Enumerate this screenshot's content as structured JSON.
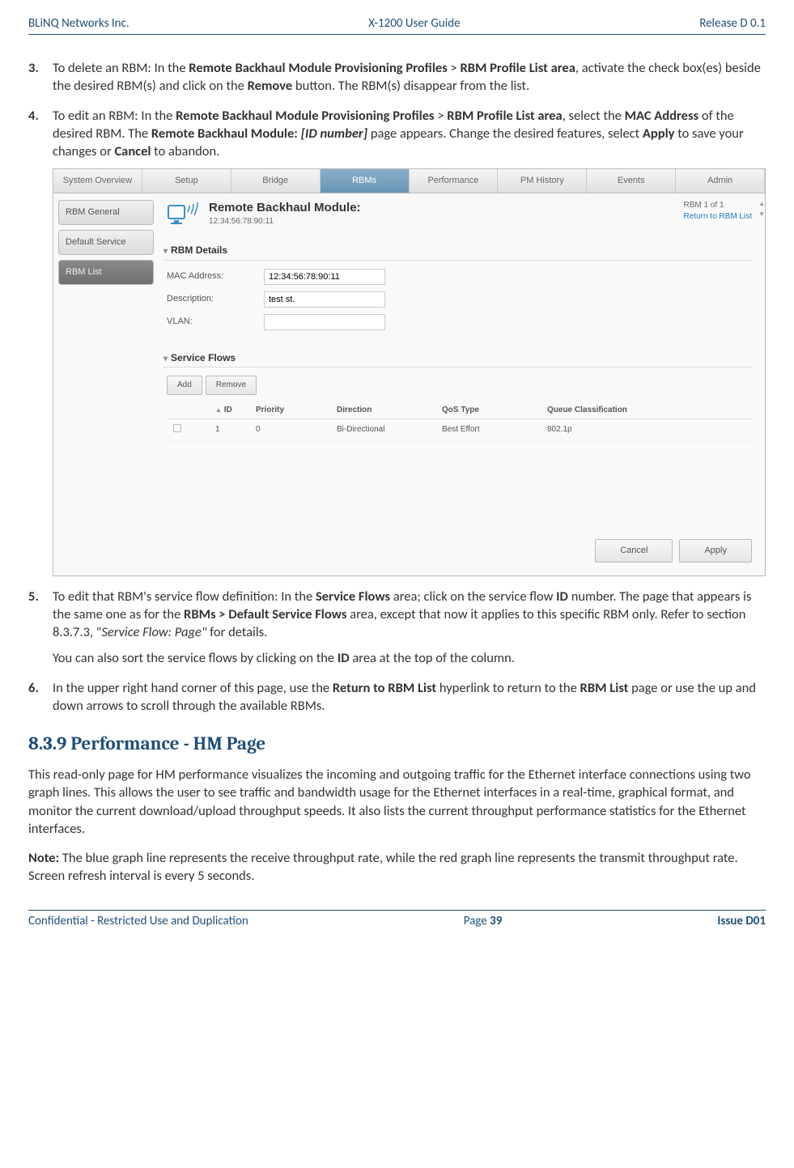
{
  "header": {
    "left": "BLiNQ Networks Inc.",
    "center": "X-1200 User Guide",
    "right": "Release D 0.1"
  },
  "footer": {
    "left": "Confidential - Restricted Use and Duplication",
    "centerPrefix": "Page ",
    "pageNum": "39",
    "right": "Issue D01"
  },
  "list": {
    "item3": {
      "num": "3.",
      "pre": "To delete an RBM: In the ",
      "b1": "Remote Backhaul Module Provisioning Profiles",
      "gt": " > ",
      "b2": "RBM Profile List area",
      "mid1": ", activate the check box(es) beside the desired RBM(s) and click on the ",
      "b3": "Remove",
      "post": " button. The RBM(s) disappear from the list."
    },
    "item4": {
      "num": "4.",
      "pre": "To edit an RBM: In the ",
      "b1": "Remote Backhaul Module Provisioning Profiles",
      "gt": " > ",
      "b2": "RBM Profile List area",
      "mid1": ", select the ",
      "b3": "MAC Address",
      "mid2": " of the desired RBM. The ",
      "b4": "Remote Backhaul Module: ",
      "i1": "[ID number]",
      "mid3": " page appears. Change the desired features, select ",
      "b5": "Apply",
      "mid4": " to save your changes or ",
      "b6": "Cancel",
      "post": " to abandon."
    },
    "item5": {
      "num": "5.",
      "pre": "To edit that RBM's service flow definition: In the ",
      "b1": "Service Flows",
      "mid1": " area; click on the service flow ",
      "b2": "ID",
      "mid2": " number. The page that appears is the same one as for the ",
      "b3": "RBMs > Default Service Flows",
      "mid3": " area, except that now it applies to this specific RBM only. Refer to section 8.3.7.3, \"",
      "i1": "Service Flow: Page\"",
      "post": " for details.",
      "p2a": "You can also sort the service flows by clicking on the ",
      "p2b": "ID",
      "p2c": " area at the top of the column."
    },
    "item6": {
      "num": "6.",
      "pre": "In the upper right hand corner of this page, use the ",
      "b1": "Return to RBM List",
      "mid1": " hyperlink to return to the ",
      "b2": "RBM List",
      "post": " page or use the up and down arrows to scroll through the available RBMs."
    }
  },
  "screenshot": {
    "tabs": [
      "System Overview",
      "Setup",
      "Bridge",
      "RBMs",
      "Performance",
      "PM History",
      "Events",
      "Admin"
    ],
    "activeTabIndex": 3,
    "leftNav": [
      "RBM General",
      "Default Service",
      "RBM List"
    ],
    "title": "Remote Backhaul Module:",
    "subtitle": "12:34:56:78:90:11",
    "navInfo": "RBM 1 of 1",
    "navLink": "Return to RBM List",
    "sections": {
      "details": {
        "heading": "RBM Details",
        "rows": [
          {
            "label": "MAC Address:",
            "value": "12:34:56:78:90:11"
          },
          {
            "label": "Description:",
            "value": "test st."
          },
          {
            "label": "VLAN:",
            "value": ""
          }
        ]
      },
      "flows": {
        "heading": "Service Flows",
        "buttons": [
          "Add",
          "Remove"
        ],
        "cols": {
          "id": "ID",
          "priority": "Priority",
          "direction": "Direction",
          "qos": "QoS Type",
          "qc": "Queue Classification"
        },
        "row": {
          "id": "1",
          "priority": "0",
          "direction": "Bi-Directional",
          "qos": "Best Effort",
          "qc": "802.1p"
        }
      }
    },
    "bottomButtons": [
      "Cancel",
      "Apply"
    ]
  },
  "section839": {
    "heading": "8.3.9 Performance - HM Page",
    "p1": "This read-only page for HM performance visualizes the incoming and outgoing traffic for the Ethernet interface connections using two graph lines. This allows the user to see traffic and bandwidth usage for the Ethernet interfaces in a real-time, graphical format, and monitor the current download/upload throughput speeds. It also lists the current throughput performance statistics for the Ethernet interfaces.",
    "noteB": "Note:",
    "noteText": " The blue graph line represents the receive throughput rate, while the red graph line represents the transmit throughput rate. Screen refresh interval is every 5 seconds."
  }
}
